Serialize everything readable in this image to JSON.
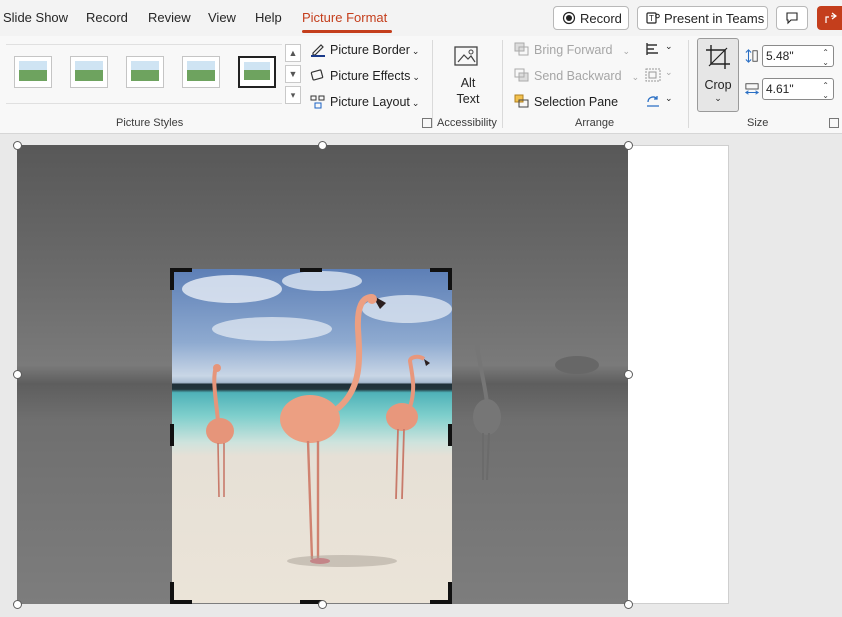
{
  "menu": {
    "tabs": [
      {
        "label": "Slide Show"
      },
      {
        "label": "Record"
      },
      {
        "label": "Review"
      },
      {
        "label": "View"
      },
      {
        "label": "Help"
      },
      {
        "label": "Picture Format",
        "active": true
      }
    ],
    "record_button": "Record",
    "present_button": "Present in Teams"
  },
  "ribbon": {
    "picture_styles": {
      "label": "Picture Styles",
      "picture_border": "Picture Border",
      "picture_effects": "Picture Effects",
      "picture_layout": "Picture Layout"
    },
    "accessibility": {
      "label": "Accessibility",
      "alt_text_line1": "Alt",
      "alt_text_line2": "Text"
    },
    "arrange": {
      "label": "Arrange",
      "bring_forward": "Bring Forward",
      "send_backward": "Send Backward",
      "selection_pane": "Selection Pane"
    },
    "size": {
      "label": "Size",
      "crop": "Crop",
      "height": "5.48\"",
      "width": "4.61\""
    }
  },
  "colors": {
    "accent": "#c43e1c"
  }
}
